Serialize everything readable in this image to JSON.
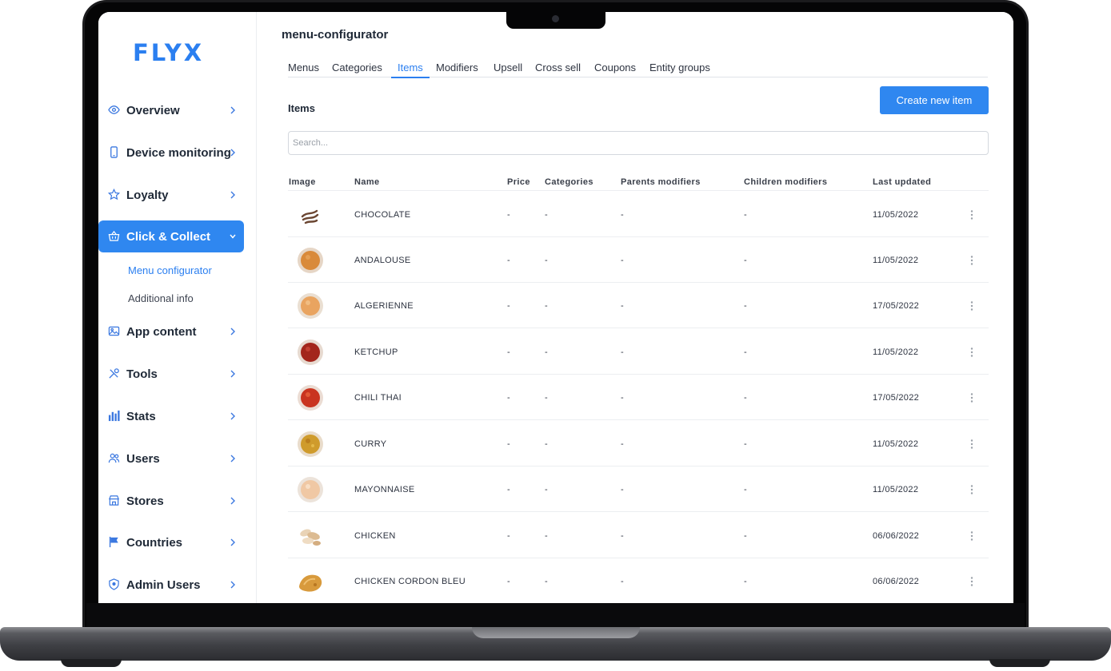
{
  "brand": {
    "logo_text": "FLYX",
    "accent": "#2f87f0"
  },
  "sidebar": {
    "items": [
      {
        "label": "Overview",
        "icon": "eye-icon"
      },
      {
        "label": "Device monitoring",
        "icon": "phone-icon"
      },
      {
        "label": "Loyalty",
        "icon": "star-icon"
      },
      {
        "label": "Click & Collect",
        "icon": "basket-icon",
        "active": true,
        "expanded": true,
        "children": [
          {
            "label": "Menu configurator",
            "active": true
          },
          {
            "label": "Additional info"
          }
        ]
      },
      {
        "label": "App content",
        "icon": "image-icon"
      },
      {
        "label": "Tools",
        "icon": "tools-icon"
      },
      {
        "label": "Stats",
        "icon": "bar-chart-icon"
      },
      {
        "label": "Users",
        "icon": "users-icon"
      },
      {
        "label": "Stores",
        "icon": "store-icon"
      },
      {
        "label": "Countries",
        "icon": "flag-icon"
      },
      {
        "label": "Admin Users",
        "icon": "shield-icon"
      }
    ]
  },
  "main": {
    "page_title": "menu-configurator",
    "tabs": [
      {
        "label": "Menus"
      },
      {
        "label": "Categories"
      },
      {
        "label": "Items",
        "active": true
      },
      {
        "label": "Modifiers"
      },
      {
        "label": "Upsell"
      },
      {
        "label": "Cross sell"
      },
      {
        "label": "Coupons"
      },
      {
        "label": "Entity groups"
      }
    ],
    "section_label": "Items",
    "create_button_label": "Create new item",
    "search": {
      "placeholder": "Search...",
      "value": ""
    },
    "table": {
      "columns": [
        "Image",
        "Name",
        "Price",
        "Categories",
        "Parents modifiers",
        "Children modifiers",
        "Last updated"
      ],
      "rows": [
        {
          "image": "chocolate-swirl-image",
          "name": "CHOCOLATE",
          "price": "-",
          "categories": "-",
          "parents_modifiers": "-",
          "children_modifiers": "-",
          "last_updated": "11/05/2022"
        },
        {
          "image": "andalouse-sauce-image",
          "name": "ANDALOUSE",
          "price": "-",
          "categories": "-",
          "parents_modifiers": "-",
          "children_modifiers": "-",
          "last_updated": "11/05/2022"
        },
        {
          "image": "algerienne-sauce-image",
          "name": "ALGERIENNE",
          "price": "-",
          "categories": "-",
          "parents_modifiers": "-",
          "children_modifiers": "-",
          "last_updated": "17/05/2022"
        },
        {
          "image": "ketchup-sauce-image",
          "name": "KETCHUP",
          "price": "-",
          "categories": "-",
          "parents_modifiers": "-",
          "children_modifiers": "-",
          "last_updated": "11/05/2022"
        },
        {
          "image": "chili-thai-sauce-image",
          "name": "CHILI THAI",
          "price": "-",
          "categories": "-",
          "parents_modifiers": "-",
          "children_modifiers": "-",
          "last_updated": "17/05/2022"
        },
        {
          "image": "curry-sauce-image",
          "name": "CURRY",
          "price": "-",
          "categories": "-",
          "parents_modifiers": "-",
          "children_modifiers": "-",
          "last_updated": "11/05/2022"
        },
        {
          "image": "mayonnaise-sauce-image",
          "name": "MAYONNAISE",
          "price": "-",
          "categories": "-",
          "parents_modifiers": "-",
          "children_modifiers": "-",
          "last_updated": "11/05/2022"
        },
        {
          "image": "chicken-pieces-image",
          "name": "CHICKEN",
          "price": "-",
          "categories": "-",
          "parents_modifiers": "-",
          "children_modifiers": "-",
          "last_updated": "06/06/2022"
        },
        {
          "image": "chicken-cordon-bleu-image",
          "name": "CHICKEN CORDON BLEU",
          "price": "-",
          "categories": "-",
          "parents_modifiers": "-",
          "children_modifiers": "-",
          "last_updated": "06/06/2022"
        }
      ]
    }
  }
}
